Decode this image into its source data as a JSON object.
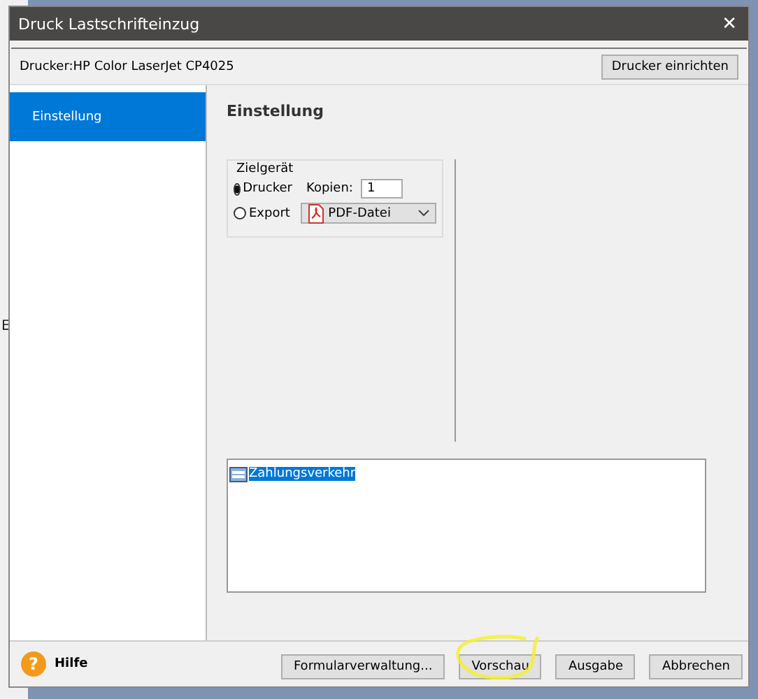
{
  "background": {
    "edge_text": "E"
  },
  "window": {
    "title": "Druck Lastschrifteinzug",
    "close": "✕"
  },
  "printer_bar": {
    "label": "Drucker:HP Color LaserJet CP4025",
    "button": "Drucker einrichten"
  },
  "sidebar": {
    "items": [
      {
        "label": "Einstellung",
        "selected": true
      }
    ]
  },
  "content": {
    "heading": "Einstellung",
    "target_group": {
      "title": "Zielgerät",
      "options": [
        {
          "label": "Drucker",
          "selected": true,
          "kind": "copies",
          "field_label": "Kopien:",
          "value": "1"
        },
        {
          "label": "Export",
          "selected": false,
          "kind": "format",
          "value": "PDF-Datei"
        }
      ]
    },
    "list": {
      "items": [
        {
          "label": "Zahlungsverkehr",
          "selected": true
        }
      ]
    }
  },
  "footer": {
    "help": "Hilfe",
    "help_icon": "?",
    "buttons": [
      {
        "label": "Formularverwaltung...",
        "highlighted": false
      },
      {
        "label": "Vorschau",
        "highlighted": true
      },
      {
        "label": "Ausgabe",
        "highlighted": false
      },
      {
        "label": "Abbrechen",
        "highlighted": false
      }
    ]
  }
}
